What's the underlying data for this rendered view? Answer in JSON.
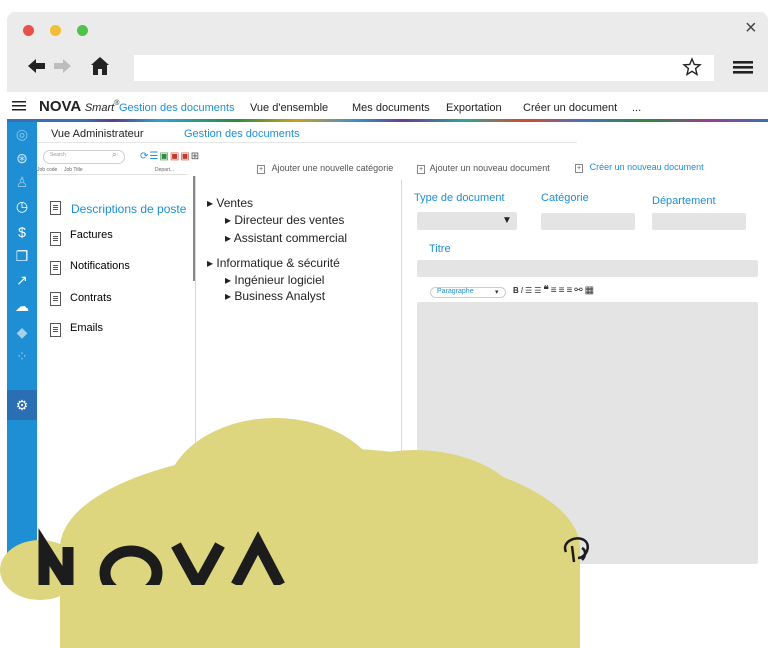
{
  "browser": {
    "back_icon": "arrow-left",
    "forward_icon": "arrow-right",
    "home_icon": "home",
    "bookmark_icon": "star-outline",
    "menu_icon": "hamburger",
    "close_glyph": "×"
  },
  "app": {
    "brand_bold": "NOVA",
    "brand_script": "Smart",
    "brand_sup": "®",
    "nav": [
      "Gestion des documents",
      "Vue d'ensemble",
      "Mes documents",
      "Exportation",
      "Créer un document",
      "..."
    ]
  },
  "breadcrumb": {
    "first": "Vue Administrateur",
    "second": "Gestion des documents"
  },
  "left_panel": {
    "search_placeholder": "Search",
    "col_headers": [
      "Job code",
      "Job Title",
      "Depart..."
    ],
    "items": [
      "Descriptions de poste",
      "Factures",
      "Notifications",
      "Contrats",
      "Emails"
    ]
  },
  "actions": {
    "add_category": "Ajouter une nouvelle catégorie",
    "add_document": "Ajouter un nouveau document",
    "create_document": "Créer un nouveau document"
  },
  "tree": [
    {
      "label": "Ventes",
      "children": [
        "Directeur des ventes",
        "Assistant commercial"
      ]
    },
    {
      "label": "Informatique & sécurité",
      "children": [
        "Ingénieur logiciel",
        "Business Analyst"
      ]
    }
  ],
  "form": {
    "type_label": "Type de document",
    "category_label": "Catégorie",
    "department_label": "Département",
    "title_label": "Titre",
    "editor_paragraph": "Paragraphe",
    "editor_tools": [
      "B",
      "I",
      "ul",
      "ol",
      "quote",
      "align-left",
      "align-center",
      "align-right",
      "link",
      "table"
    ]
  },
  "colors": {
    "accent": "#1e8fd4",
    "blob": "#ddd67f",
    "panel_bg": "#ffffff",
    "window_bg": "#ebebeb"
  }
}
